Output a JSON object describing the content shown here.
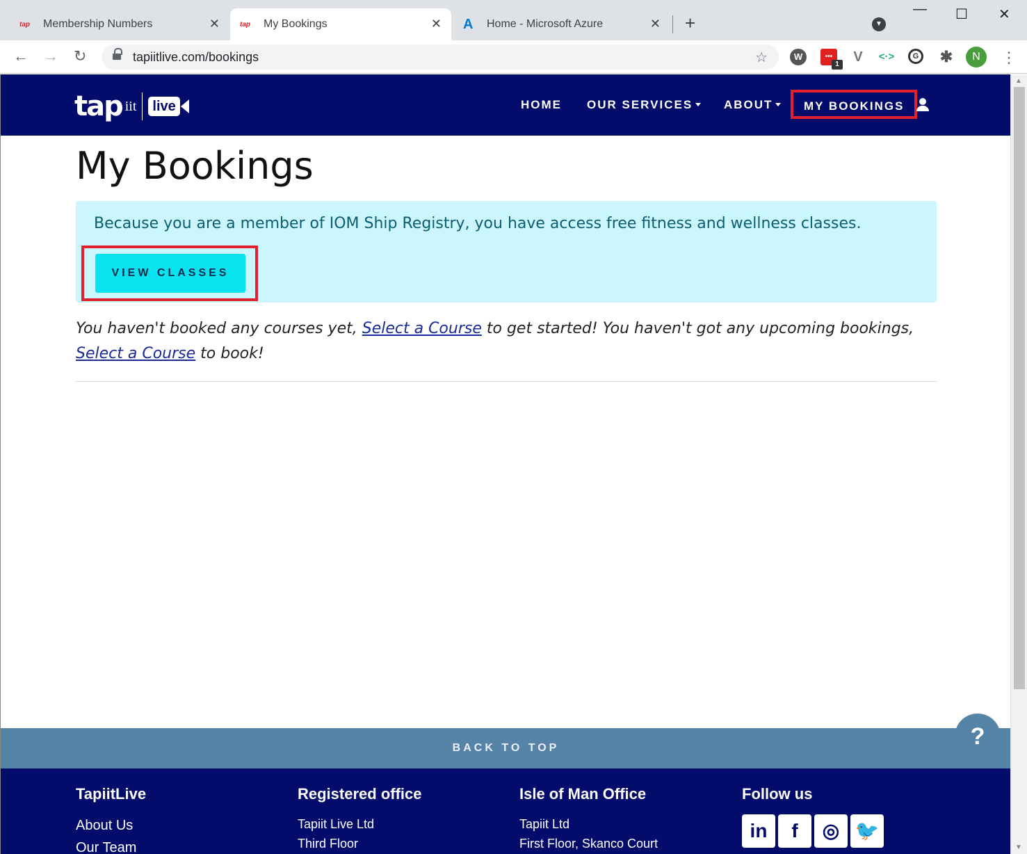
{
  "browser": {
    "tabs": [
      {
        "title": "Membership Numbers",
        "favicon": "tap"
      },
      {
        "title": "My Bookings",
        "favicon": "tap"
      },
      {
        "title": "Home - Microsoft Azure",
        "favicon": "A"
      }
    ],
    "new_tab": "+",
    "url": "tapiitlive.com/bookings",
    "profile_initial": "N",
    "extension_badge": "1"
  },
  "header": {
    "logo_tap": "tap",
    "logo_iit": "iit",
    "logo_live": "live",
    "nav": {
      "home": "HOME",
      "services": "OUR SERVICES",
      "about": "ABOUT",
      "bookings": "MY BOOKINGS"
    }
  },
  "main": {
    "title": "My Bookings",
    "alert_text": "Because you are a member of IOM Ship Registry, you have access free fitness and wellness classes.",
    "view_classes": "VIEW CLASSES",
    "info": {
      "part1": "You haven't booked any courses yet, ",
      "link1": "Select a Course",
      "part2": " to get started! You haven't got any upcoming bookings, ",
      "link2": "Select a Course",
      "part3": " to book!"
    }
  },
  "back_to_top": "BACK TO TOP",
  "footer": {
    "col1": {
      "title": "TapiitLive",
      "items": [
        "About Us",
        "Our Team"
      ]
    },
    "col2": {
      "title": "Registered office",
      "items": [
        "Tapiit Live Ltd",
        "Third Floor"
      ]
    },
    "col3": {
      "title": "Isle of Man Office",
      "items": [
        "Tapiit Ltd",
        "First Floor, Skanco Court"
      ]
    },
    "col4": {
      "title": "Follow us",
      "social": [
        "in",
        "f",
        "◎",
        "🐦"
      ]
    }
  },
  "help_label": "?",
  "colors": {
    "header": "#030b6b",
    "alert_bg": "#cbf6fd",
    "button": "#09e3ef",
    "highlight": "#e2202e",
    "back_to_top": "#5584a7"
  }
}
